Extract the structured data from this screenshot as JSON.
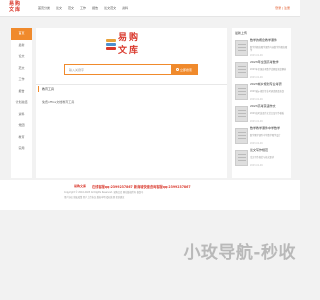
{
  "logo": {
    "line1": "易购",
    "line2": "文库",
    "brand_color": "#d9372b"
  },
  "nav": {
    "items": [
      "首页分类",
      "论文",
      "范文",
      "工作",
      "报告",
      "论文范文",
      "资料"
    ]
  },
  "top_right": {
    "text": "登录 | 注册"
  },
  "sidebar": {
    "accent": "#f08a2c",
    "items": [
      "首页",
      "最新",
      "论文",
      "范文",
      "工作",
      "报告",
      "计划总结",
      "资料",
      "党团",
      "教育",
      "实用"
    ]
  },
  "main": {
    "search": {
      "placeholder": "输入关键字",
      "button": "立即搜索"
    },
    "section_title": "教育工具",
    "section_text": "免费office文档教育工具"
  },
  "right_panel": {
    "title": "最新上传",
    "articles": [
      {
        "title": "数学的概念教学课件",
        "desc": "数学的概念教学课件内容数学的概念教学",
        "date": "2023-01-06"
      },
      {
        "title": "2023年全国高考数学",
        "desc": "2023年全国高考数学试题及答案解析",
        "date": "2023-01-06"
      },
      {
        "title": "2023城乡规划专业考研",
        "desc": "2023城乡规划专业考研真题及答案",
        "date": "2023-01-06"
      },
      {
        "title": "2023高考英语作文",
        "desc": "2023高考英语作文范文及写作模板",
        "date": "2023-01-06"
      },
      {
        "title": "数学教学课件中学数学",
        "desc": "数学教学课件中学数学教学设计",
        "date": "2023-01-06"
      },
      {
        "title": "论文写作规范",
        "desc": "论文写作规范与格式要求",
        "date": "2023-01-06"
      }
    ]
  },
  "footer": {
    "logo": "易购文库",
    "main": "在线客服qq:2399237867  新商城快速咨询客服qq:2399237867",
    "copyright": "Copyright © 2016-2023 All Rights Reserved. 易购文库 网站版权所有 备案号",
    "links": "用户协议  隐私政策  用户上传协议  版权申明  侵权处理  投诉建议"
  },
  "watermark": "小玫导航-秒收"
}
